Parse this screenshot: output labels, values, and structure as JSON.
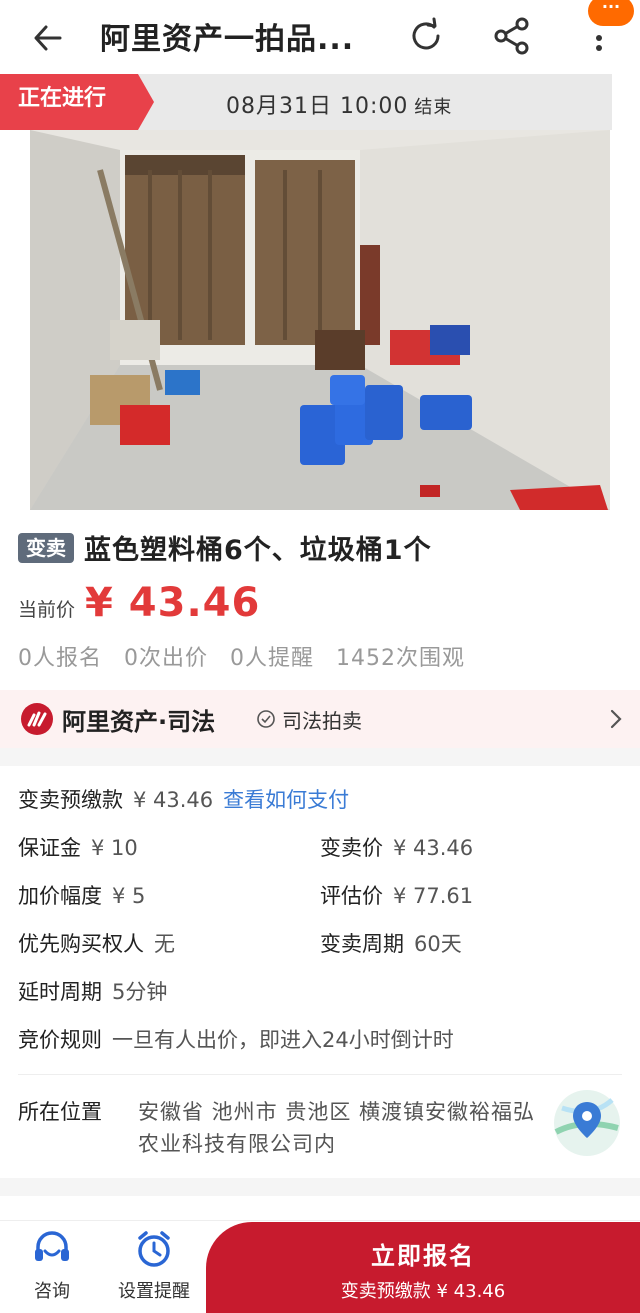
{
  "header": {
    "title": "阿里资产一拍品...",
    "badge": "···"
  },
  "status": {
    "tag": "正在进行",
    "end_time": "08月31日 10:00",
    "end_label": "结束"
  },
  "item": {
    "type_tag": "变卖",
    "name": "蓝色塑料桶6个、垃圾桶1个",
    "price_label": "当前价",
    "price_value": "¥ 43.46",
    "stats": [
      "0人报名",
      "0次出价",
      "0人提醒",
      "1452次围观"
    ]
  },
  "brand": {
    "name": "阿里资产·司法",
    "judicial_label": "司法拍卖"
  },
  "info": {
    "prepay_label": "变卖预缴款",
    "prepay_value": "¥ 43.46",
    "prepay_link": "查看如何支付",
    "deposit_label": "保证金",
    "deposit_value": "¥ 10",
    "sell_price_label": "变卖价",
    "sell_price_value": "¥ 43.46",
    "increment_label": "加价幅度",
    "increment_value": "¥ 5",
    "appraisal_label": "评估价",
    "appraisal_value": "¥ 77.61",
    "priority_label": "优先购买权人",
    "priority_value": "无",
    "period_label": "变卖周期",
    "period_value": "60天",
    "delay_label": "延时周期",
    "delay_value": "5分钟",
    "rule_label": "竞价规则",
    "rule_value": "一旦有人出价，即进入24小时倒计时",
    "location_label": "所在位置",
    "location_value": "安徽省 池州市 贵池区 横渡镇安徽裕福弘农业科技有限公司内"
  },
  "bottom": {
    "consult_label": "咨询",
    "remind_label": "设置提醒",
    "signup_label": "立即报名",
    "signup_sub": "变卖预缴款 ¥ 43.46"
  },
  "colors": {
    "accent_red": "#e8414a",
    "price_red": "#e23a3a",
    "button_red": "#c71b2e",
    "link_blue": "#3a7bd5",
    "tag_gray": "#5f6b7b"
  }
}
